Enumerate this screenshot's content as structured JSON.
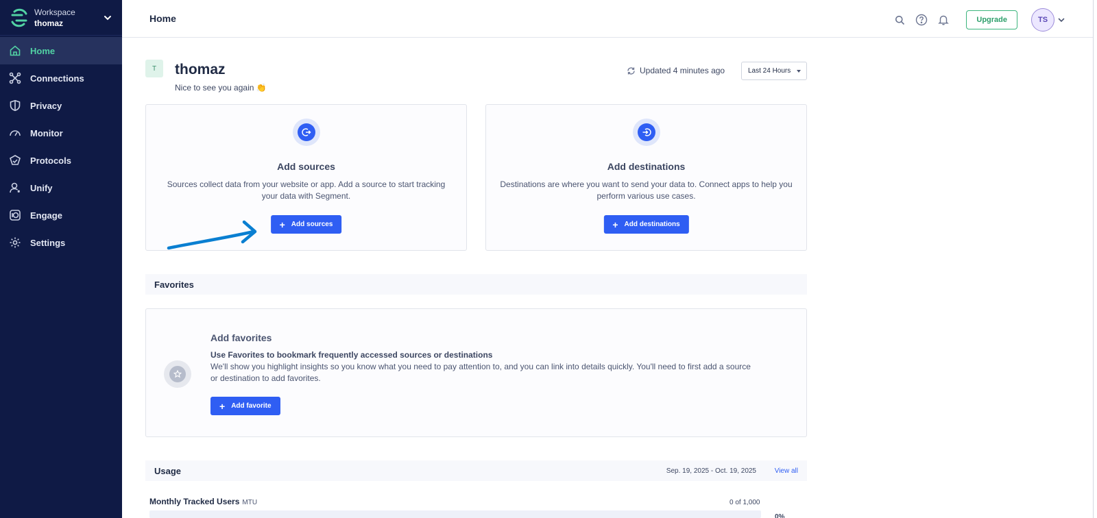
{
  "workspace": {
    "label": "Workspace",
    "name": "thomaz"
  },
  "sidebar": {
    "items": [
      {
        "label": "Home",
        "icon": "home-icon",
        "active": true
      },
      {
        "label": "Connections",
        "icon": "connections-icon"
      },
      {
        "label": "Privacy",
        "icon": "shield-icon"
      },
      {
        "label": "Monitor",
        "icon": "gauge-icon"
      },
      {
        "label": "Protocols",
        "icon": "protocols-icon"
      },
      {
        "label": "Unify",
        "icon": "user-icon"
      },
      {
        "label": "Engage",
        "icon": "engage-icon"
      },
      {
        "label": "Settings",
        "icon": "gear-icon"
      }
    ]
  },
  "topbar": {
    "title": "Home",
    "upgrade_label": "Upgrade",
    "avatar_initials": "TS"
  },
  "greeting": {
    "badge": "T",
    "name": "thomaz",
    "subtitle": "Nice to see you again 👏",
    "updated": "Updated 4 minutes ago",
    "range": "Last 24 Hours"
  },
  "sources_card": {
    "title": "Add sources",
    "description": "Sources collect data from your website or app. Add a source to start tracking your data with Segment.",
    "button": "Add sources"
  },
  "destinations_card": {
    "title": "Add destinations",
    "description": "Destinations are where you want to send your data to. Connect apps to help you perform various use cases.",
    "button": "Add destinations"
  },
  "favorites": {
    "heading": "Favorites",
    "title": "Add favorites",
    "subtitle": "Use Favorites to bookmark frequently accessed sources or destinations",
    "description": "We'll show you highlight insights so you know what you need to pay attention to, and you can link into details quickly. You'll need to first add a source or destination to add favorites.",
    "button": "Add favorite"
  },
  "usage": {
    "heading": "Usage",
    "range": "Sep. 19, 2025 - Oct. 19, 2025",
    "view_all": "View all",
    "mtu_label": "Monthly Tracked Users",
    "mtu_tag": "MTU",
    "count": "0 of 1,000",
    "percent_label": "0%",
    "fill_fraction": 0
  },
  "colors": {
    "sidebar_bg": "#0f1a45",
    "accent_green": "#52d2a4",
    "primary_blue": "#2f5ef3",
    "annotation_arrow": "#0a7fd1"
  }
}
